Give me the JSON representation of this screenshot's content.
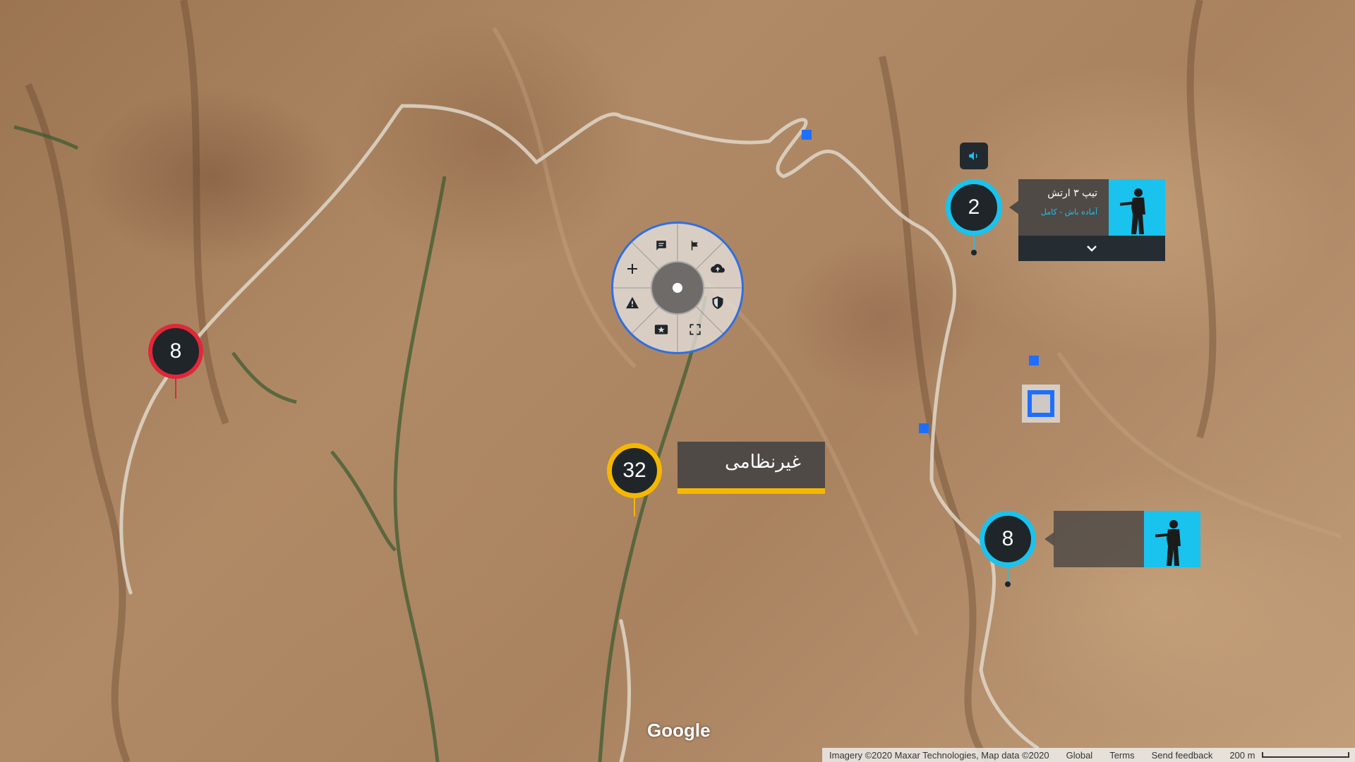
{
  "map": {
    "provider_logo": "Google",
    "attribution": "Imagery ©2020 Maxar Technologies, Map data ©2020",
    "region": "Global",
    "terms_link": "Terms",
    "feedback_link": "Send feedback",
    "scale_label": "200 m"
  },
  "markers": [
    {
      "id": "red-8",
      "count": "8",
      "ring_color": "#e0283a"
    },
    {
      "id": "blue-2",
      "count": "2",
      "ring_color": "#19c3ee"
    },
    {
      "id": "yellow-32",
      "count": "32",
      "ring_color": "#f5b800"
    },
    {
      "id": "blue-8",
      "count": "8",
      "ring_color": "#19c3ee"
    }
  ],
  "unit_card": {
    "title": "تیپ ۳ ارتش",
    "subtitle": "آماده باش - کامل",
    "avatar_icon": "soldier-icon",
    "expand_icon": "chevron-down-icon"
  },
  "civilian_label": {
    "text": "غیرنظامی",
    "accent_color": "#f5b800"
  },
  "radial_menu": {
    "items": [
      "comment-icon",
      "flag-icon",
      "cloud-upload-icon",
      "shield-icon",
      "fullscreen-icon",
      "star-badge-icon",
      "warning-icon",
      "add-icon"
    ],
    "accent_color": "#2f6fe0"
  },
  "speaker_button": {
    "icon": "speaker-icon"
  },
  "colors": {
    "accent_blue": "#1e6fff",
    "cyan": "#19c3ee",
    "dark_panel": "#262d32"
  }
}
